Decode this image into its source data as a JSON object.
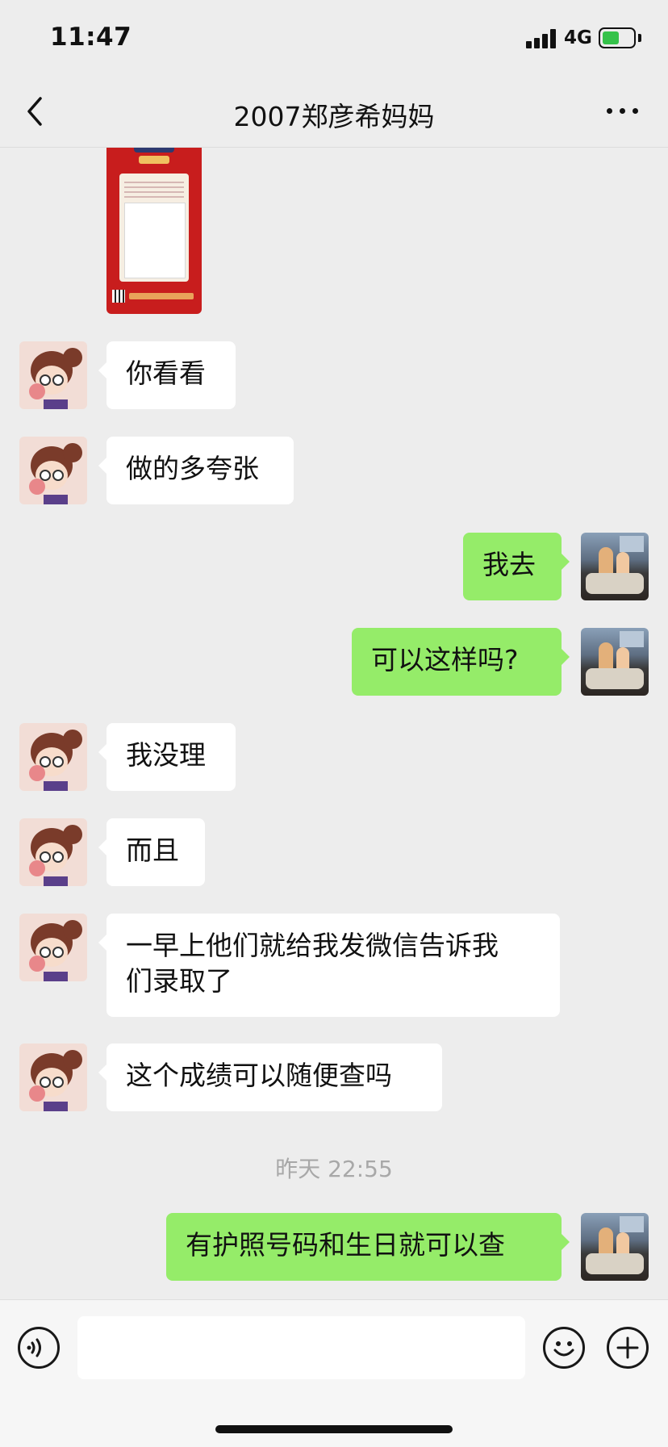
{
  "status_bar": {
    "time": "11:47",
    "network": "4G",
    "icons": [
      "signal-icon",
      "battery-charging-icon"
    ]
  },
  "nav": {
    "title": "2007郑彦希妈妈",
    "back_icon": "chevron-left-icon",
    "more_icon": "more-dots-icon"
  },
  "messages": [
    {
      "side": "left",
      "kind": "image",
      "description": "red poster image"
    },
    {
      "side": "left",
      "text": "你看看"
    },
    {
      "side": "left",
      "text": "做的多夸张"
    },
    {
      "side": "right",
      "text": "我去"
    },
    {
      "side": "right",
      "text": "可以这样吗?"
    },
    {
      "side": "left",
      "text": "我没理"
    },
    {
      "side": "left",
      "text": "而且"
    },
    {
      "side": "left",
      "text": "一早上他们就给我发微信告诉我\n们录取了"
    },
    {
      "side": "left",
      "text": "这个成绩可以随便查吗"
    },
    {
      "kind": "timestamp",
      "text": "昨天 22:55"
    },
    {
      "side": "right",
      "text": "有护照号码和生日就可以查"
    }
  ],
  "input_bar": {
    "voice_icon": "voice-icon",
    "emoji_icon": "emoji-icon",
    "plus_icon": "plus-icon",
    "value": ""
  },
  "colors": {
    "background": "#ededed",
    "bubble_self": "#95ec69",
    "bubble_other": "#ffffff"
  }
}
